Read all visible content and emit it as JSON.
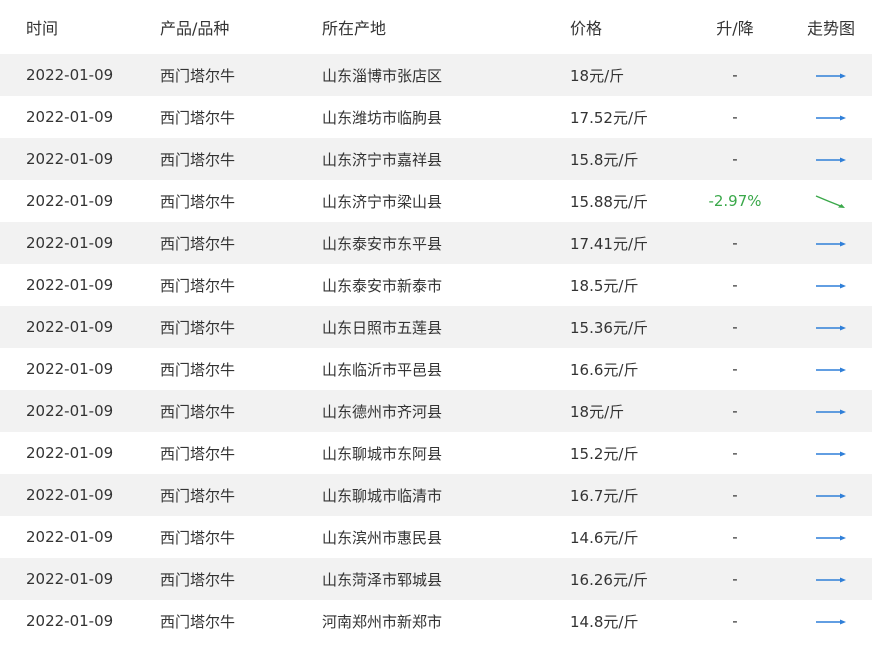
{
  "table": {
    "headers": {
      "date": "时间",
      "product": "产品/品种",
      "location": "所在产地",
      "price": "价格",
      "change": "升/降",
      "trend": "走势图"
    },
    "rows": [
      {
        "date": "2022-01-09",
        "product": "西门塔尔牛",
        "location": "山东淄博市张店区",
        "price": "18元/斤",
        "change": "-",
        "trend": "flat-arrow-icon"
      },
      {
        "date": "2022-01-09",
        "product": "西门塔尔牛",
        "location": "山东潍坊市临朐县",
        "price": "17.52元/斤",
        "change": "-",
        "trend": "flat-arrow-icon"
      },
      {
        "date": "2022-01-09",
        "product": "西门塔尔牛",
        "location": "山东济宁市嘉祥县",
        "price": "15.8元/斤",
        "change": "-",
        "trend": "flat-arrow-icon"
      },
      {
        "date": "2022-01-09",
        "product": "西门塔尔牛",
        "location": "山东济宁市梁山县",
        "price": "15.88元/斤",
        "change": "-2.97%",
        "trend": "down-arrow-icon"
      },
      {
        "date": "2022-01-09",
        "product": "西门塔尔牛",
        "location": "山东泰安市东平县",
        "price": "17.41元/斤",
        "change": "-",
        "trend": "flat-arrow-icon"
      },
      {
        "date": "2022-01-09",
        "product": "西门塔尔牛",
        "location": "山东泰安市新泰市",
        "price": "18.5元/斤",
        "change": "-",
        "trend": "flat-arrow-icon"
      },
      {
        "date": "2022-01-09",
        "product": "西门塔尔牛",
        "location": "山东日照市五莲县",
        "price": "15.36元/斤",
        "change": "-",
        "trend": "flat-arrow-icon"
      },
      {
        "date": "2022-01-09",
        "product": "西门塔尔牛",
        "location": "山东临沂市平邑县",
        "price": "16.6元/斤",
        "change": "-",
        "trend": "flat-arrow-icon"
      },
      {
        "date": "2022-01-09",
        "product": "西门塔尔牛",
        "location": "山东德州市齐河县",
        "price": "18元/斤",
        "change": "-",
        "trend": "flat-arrow-icon"
      },
      {
        "date": "2022-01-09",
        "product": "西门塔尔牛",
        "location": "山东聊城市东阿县",
        "price": "15.2元/斤",
        "change": "-",
        "trend": "flat-arrow-icon"
      },
      {
        "date": "2022-01-09",
        "product": "西门塔尔牛",
        "location": "山东聊城市临清市",
        "price": "16.7元/斤",
        "change": "-",
        "trend": "flat-arrow-icon"
      },
      {
        "date": "2022-01-09",
        "product": "西门塔尔牛",
        "location": "山东滨州市惠民县",
        "price": "14.6元/斤",
        "change": "-",
        "trend": "flat-arrow-icon"
      },
      {
        "date": "2022-01-09",
        "product": "西门塔尔牛",
        "location": "山东菏泽市郓城县",
        "price": "16.26元/斤",
        "change": "-",
        "trend": "flat-arrow-icon"
      },
      {
        "date": "2022-01-09",
        "product": "西门塔尔牛",
        "location": "河南郑州市新郑市",
        "price": "14.8元/斤",
        "change": "-",
        "trend": "flat-arrow-icon"
      }
    ]
  },
  "colors": {
    "flat_arrow": "#2f7fd8",
    "down_arrow": "#3aa84a",
    "change_down_text": "#3aa84a",
    "stripe": "#f2f2f2"
  }
}
